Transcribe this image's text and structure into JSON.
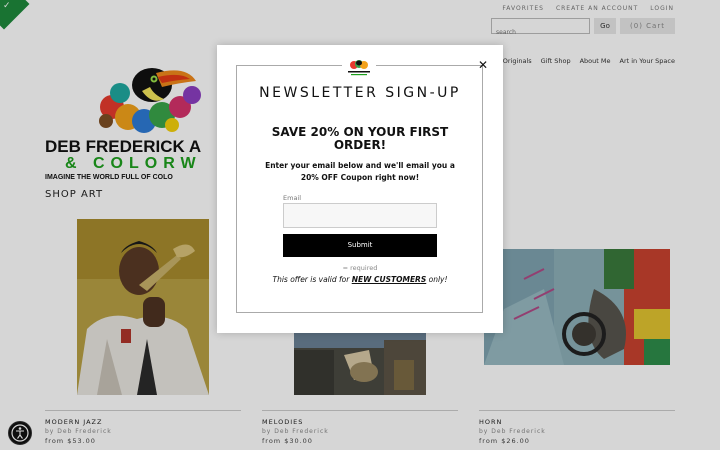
{
  "header": {
    "top_links": [
      "FAVORITES",
      "CREATE AN ACCOUNT",
      "LOGIN"
    ],
    "search_placeholder": "search",
    "go_label": "Go",
    "cart_label": "(0)  Cart"
  },
  "nav": {
    "items": [
      "Originals",
      "Gift Shop",
      "About Me",
      "Art in Your Space"
    ],
    "partial_item": "t"
  },
  "brand": {
    "name": "DEB FREDERICK A",
    "sub": "& COLORW",
    "tagline": "IMAGINE THE WORLD FULL OF COLO"
  },
  "shop": {
    "title": "SHOP ART",
    "products": [
      {
        "title": "MODERN JAZZ",
        "by": "by Deb Frederick",
        "price": "from $53.00"
      },
      {
        "title": "MELODIES",
        "by": "by Deb Frederick",
        "price": "from $30.00"
      },
      {
        "title": "HORN",
        "by": "by Deb Frederick",
        "price": "from $26.00"
      }
    ]
  },
  "modal": {
    "heading": "NEWSLETTER SIGN-UP",
    "save_text": "SAVE 20% ON YOUR FIRST ORDER!",
    "description": "Enter your email below and we'll email you a 20% OFF Coupon right now!",
    "email_label": "Email",
    "submit_label": "Submit",
    "required_note": "= required",
    "offer_prefix": "This offer is valid for ",
    "offer_bold": "NEW CUSTOMERS",
    "offer_suffix": " only!"
  },
  "colors": {
    "brand_green": "#1ea01e",
    "badge_green": "#1e8a3c",
    "submit_bg": "#000000"
  },
  "icons": [
    "check-icon",
    "close-icon",
    "accessibility-icon",
    "logo-toucan-icon"
  ]
}
